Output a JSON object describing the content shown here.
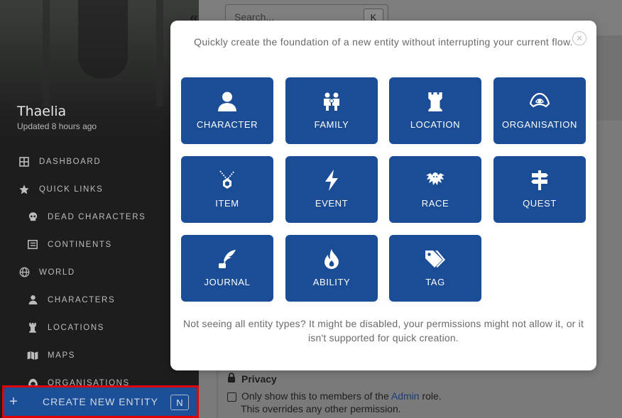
{
  "sidebar": {
    "world_name": "Thaelia",
    "updated": "Updated 8 hours ago",
    "items": [
      {
        "label": "DASHBOARD",
        "icon": "dashboard-icon",
        "level": 0
      },
      {
        "label": "QUICK LINKS",
        "icon": "star-icon",
        "level": 0
      },
      {
        "label": "DEAD CHARACTERS",
        "icon": "skull-icon",
        "level": 1
      },
      {
        "label": "CONTINENTS",
        "icon": "list-icon",
        "level": 1
      },
      {
        "label": "WORLD",
        "icon": "globe-icon",
        "level": 0
      },
      {
        "label": "CHARACTERS",
        "icon": "user-icon",
        "level": 1
      },
      {
        "label": "LOCATIONS",
        "icon": "castle-icon",
        "level": 1
      },
      {
        "label": "MAPS",
        "icon": "map-icon",
        "level": 1
      },
      {
        "label": "ORGANISATIONS",
        "icon": "hood-icon",
        "level": 1
      }
    ],
    "create_button": {
      "label": "CREATE NEW ENTITY",
      "shortcut": "N"
    }
  },
  "topbar": {
    "collapse_icon": "double-chevron-left-icon",
    "search": {
      "placeholder": "Search...",
      "shortcut": "K"
    }
  },
  "privacy": {
    "heading": "Privacy",
    "checkbox_before": "Only show this to members of the ",
    "checkbox_link": "Admin",
    "checkbox_after": " role.",
    "checkbox_line2": "This overrides any other permission."
  },
  "modal": {
    "intro": "Quickly create the foundation of a new entity without interrupting your current flow.",
    "footer": "Not seeing all entity types? It might be disabled, your permissions might not allow it, or it isn't supported for quick creation.",
    "tiles": [
      {
        "label": "CHARACTER",
        "icon": "user-icon"
      },
      {
        "label": "FAMILY",
        "icon": "family-icon"
      },
      {
        "label": "LOCATION",
        "icon": "tower-icon"
      },
      {
        "label": "ORGANISATION",
        "icon": "hood-icon"
      },
      {
        "label": "ITEM",
        "icon": "amulet-icon"
      },
      {
        "label": "EVENT",
        "icon": "lightning-icon"
      },
      {
        "label": "RACE",
        "icon": "dragon-icon"
      },
      {
        "label": "QUEST",
        "icon": "signpost-icon"
      },
      {
        "label": "JOURNAL",
        "icon": "quill-ink-icon"
      },
      {
        "label": "ABILITY",
        "icon": "flame-icon"
      },
      {
        "label": "TAG",
        "icon": "tags-icon"
      }
    ]
  },
  "colors": {
    "tile": "#1a4d96",
    "create_highlight": "#e00000",
    "sidebar_bg": "#1d1d1d"
  }
}
